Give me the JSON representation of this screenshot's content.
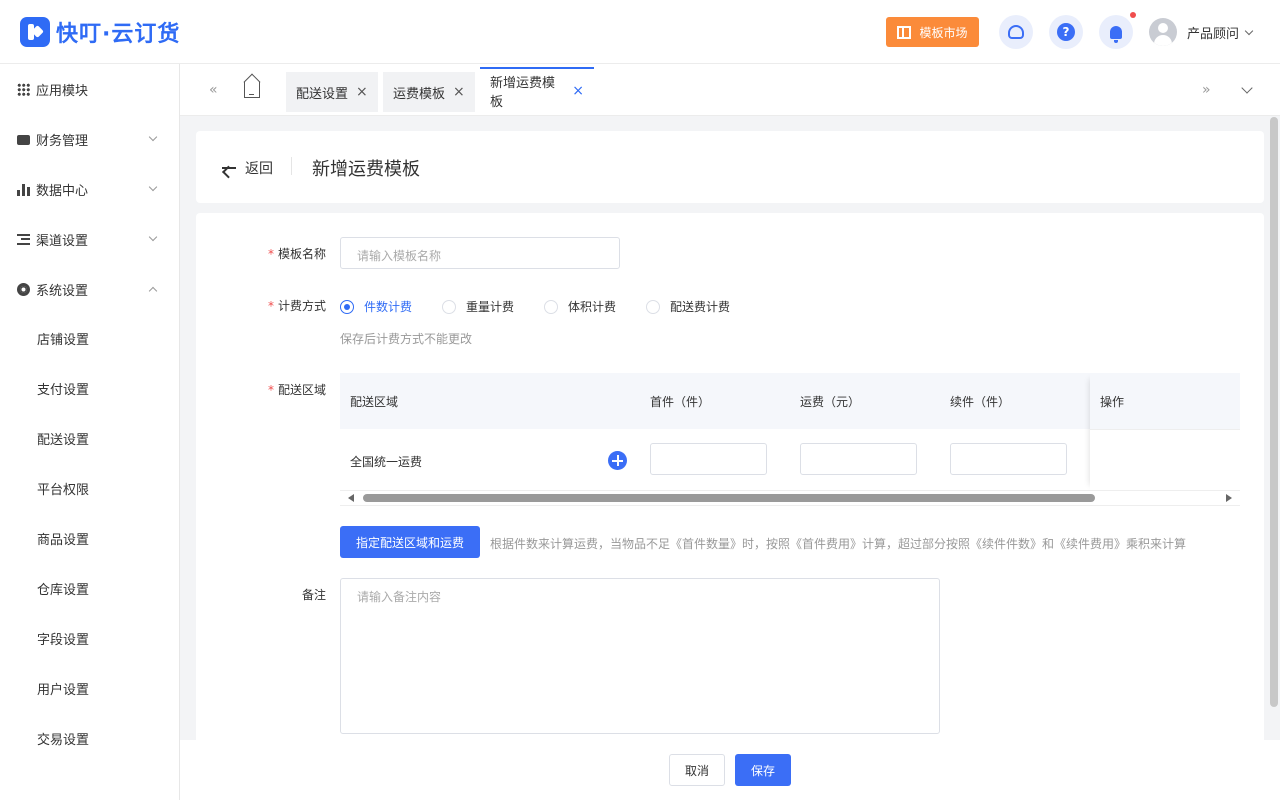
{
  "app": {
    "brand": "快叮·云订货"
  },
  "header": {
    "template_market": "模板市场",
    "icons": [
      "customer-service-icon",
      "help-icon",
      "bell-icon"
    ],
    "user_name": "产品顾问"
  },
  "sidebar": {
    "groups": [
      {
        "label": "应用模块",
        "icon": "grid-icon"
      },
      {
        "label": "财务管理",
        "icon": "wallet-icon",
        "expanded": false
      },
      {
        "label": "数据中心",
        "icon": "bar-chart-icon",
        "expanded": false
      },
      {
        "label": "渠道设置",
        "icon": "list-icon",
        "expanded": false
      },
      {
        "label": "系统设置",
        "icon": "gear-icon",
        "expanded": true
      }
    ],
    "sub_items": [
      "店铺设置",
      "支付设置",
      "配送设置",
      "平台权限",
      "商品设置",
      "仓库设置",
      "字段设置",
      "用户设置",
      "交易设置"
    ]
  },
  "tabs": {
    "items": [
      {
        "label": "配送设置",
        "active": false
      },
      {
        "label": "运费模板",
        "active": false
      },
      {
        "label": "新增运费模板",
        "active": true
      }
    ],
    "close_glyph": "×"
  },
  "page": {
    "back_label": "返回",
    "title": "新增运费模板"
  },
  "form": {
    "required_mark": "*",
    "name_label": "模板名称",
    "name_placeholder": "请输入模板名称",
    "billing_label": "计费方式",
    "billing_options": [
      "件数计费",
      "重量计费",
      "体积计费",
      "配送费计费"
    ],
    "billing_selected": "件数计费",
    "billing_hint": "保存后计费方式不能更改",
    "region_label": "配送区域",
    "table": {
      "headers": [
        "配送区域",
        "首件（件）",
        "运费（元）",
        "续件（件）",
        "操作"
      ],
      "rows": [
        {
          "region": "全国统一运费",
          "first": "",
          "fee": "",
          "additional": ""
        }
      ]
    },
    "assign_button": "指定配送区域和运费",
    "assign_hint": "根据件数来计算运费，当物品不足《首件数量》时，按照《首件费用》计算，超过部分按照《续件件数》和《续件费用》乘积来计算",
    "remark_label": "备注",
    "remark_placeholder": "请输入备注内容"
  },
  "footer": {
    "cancel": "取消",
    "save": "保存"
  },
  "colors": {
    "primary": "#3b6ef6",
    "brand": "#2f6bf5",
    "orange": "#fb8b3a",
    "required": "#f04d4d"
  }
}
